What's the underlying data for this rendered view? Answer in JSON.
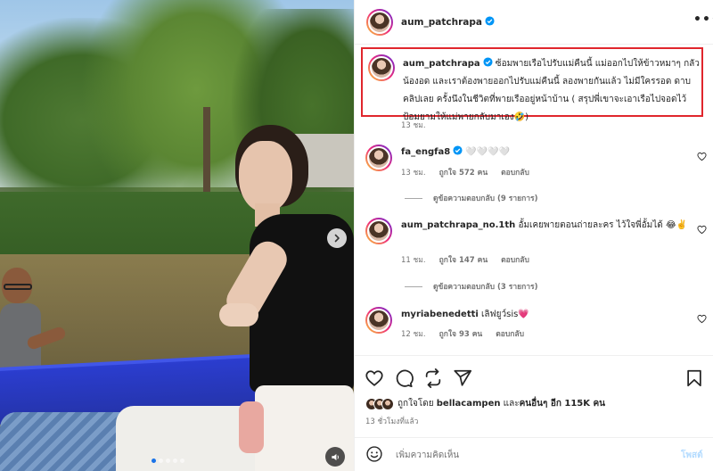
{
  "post": {
    "username": "aum_patchrapa",
    "more_label": "•••"
  },
  "caption": {
    "username": "aum_patchrapa",
    "text": "ซ้อมพายเรือไปรับแม่คืนนี้ แม่ออกไปให้ข้าวหมาๆ กลัวน้องอด และเราต้องพายออกไปรับแม่คืนนี้ ลองพายกันแล้ว ไม่มีใครรอด ดาบคลิปเลย ครั้งนึงในชีวิตที่พายเรืออยู่หน้าบ้าน ( สรุปพี่เขาจะเอาเรือไปจอดไว้ป้อมยามให้แม่พายกลับมาเอง🤣)",
    "time": "13 ชม."
  },
  "comments": [
    {
      "username": "fa_engfa8",
      "text": "🤍🤍🤍🤍",
      "time": "13 ชม.",
      "likes": "ถูกใจ 572 คน",
      "reply_label": "ตอบกลับ",
      "view_replies": "ดูข้อความตอบกลับ (9 รายการ)"
    },
    {
      "username": "aum_patchrapa_no.1th",
      "text": "อั้มเคยพายตอนถ่ายละคร ไว้ใจพี่อั้มได้ 😂✌️",
      "time": "11 ชม.",
      "likes": "ถูกใจ 147 คน",
      "reply_label": "ตอบกลับ",
      "view_replies": "ดูข้อความตอบกลับ (3 รายการ)"
    },
    {
      "username": "myriabenedetti",
      "text": "เลิฟยูว์sis💗",
      "time": "12 ชม.",
      "likes": "ถูกใจ 93 คน",
      "reply_label": "ตอบกลับ"
    }
  ],
  "likes": {
    "prefix": "ถูกใจโดย",
    "user": "bellacampen",
    "and": "และ",
    "others": "คนอื่นๆ อีก 115K คน"
  },
  "post_time": "13 ชั่วโมงที่แล้ว",
  "add_comment": {
    "placeholder": "เพิ่มความคิดเห็น",
    "post_label": "โพสต์"
  },
  "colors": {
    "highlight_border": "#e0262d",
    "verified": "#0095f6",
    "post_button_disabled": "#b3dbff",
    "carousel_active_dot": "#1a73e8"
  },
  "icons": [
    "next-arrow-icon",
    "sound-icon",
    "verified-icon",
    "heart-icon",
    "comment-icon",
    "share-icon",
    "send-icon",
    "bookmark-icon",
    "emoji-icon"
  ]
}
